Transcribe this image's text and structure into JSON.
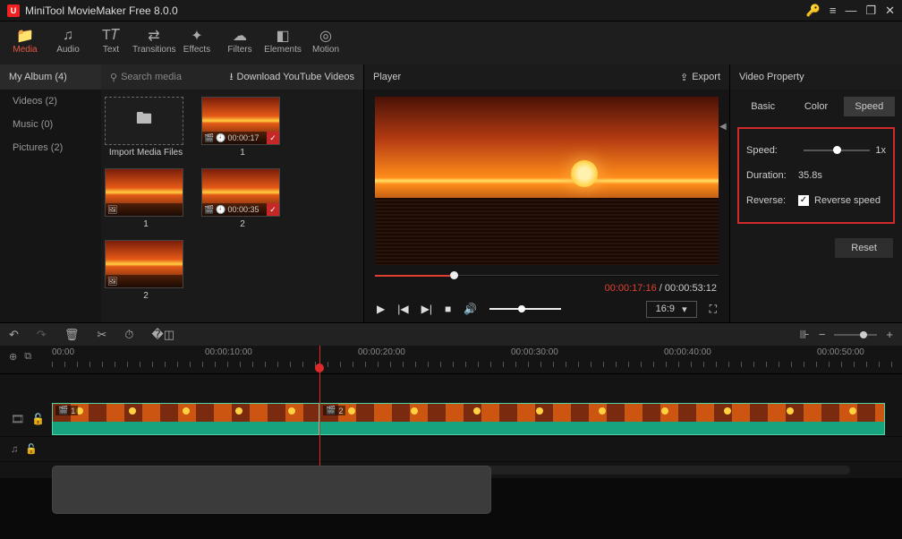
{
  "app": {
    "title": "MiniTool MovieMaker Free 8.0.0"
  },
  "ribbon": [
    {
      "label": "Media",
      "icon": "📁",
      "active": true
    },
    {
      "label": "Audio",
      "icon": "♫"
    },
    {
      "label": "Text",
      "icon": "T𝑇"
    },
    {
      "label": "Transitions",
      "icon": "⇄"
    },
    {
      "label": "Effects",
      "icon": "✦"
    },
    {
      "label": "Filters",
      "icon": "☁"
    },
    {
      "label": "Elements",
      "icon": "◧"
    },
    {
      "label": "Motion",
      "icon": "◎"
    }
  ],
  "album": {
    "header": "My Album (4)",
    "items": [
      {
        "label": "Videos (2)"
      },
      {
        "label": "Music (0)"
      },
      {
        "label": "Pictures (2)"
      }
    ]
  },
  "search": {
    "placeholder": "Search media",
    "download": "Download YouTube Videos"
  },
  "media": {
    "import_label": "Import Media Files",
    "caps": [
      "1",
      "1",
      "1",
      "2",
      "2"
    ],
    "durations": [
      "00:00:17",
      "00:00:35"
    ]
  },
  "player": {
    "title": "Player",
    "export": "Export",
    "cur": "00:00:17:16",
    "total": "00:00:53:12",
    "aspect": "16:9"
  },
  "prop": {
    "title": "Video Property",
    "tabs": [
      "Basic",
      "Color",
      "Speed"
    ],
    "speed_label": "Speed:",
    "speed_value": "1x",
    "duration_label": "Duration:",
    "duration_value": "35.8s",
    "reverse_label": "Reverse:",
    "reverse_chk": "Reverse speed",
    "reset": "Reset"
  },
  "ruler": {
    "labels": [
      "00:00",
      "00:00:10:00",
      "00:00:20:00",
      "00:00:30:00",
      "00:00:40:00",
      "00:00:50:00"
    ],
    "positions": [
      0,
      18,
      36,
      54,
      72,
      90
    ]
  },
  "clips": {
    "a": {
      "label": "1"
    },
    "b": {
      "label": "2"
    }
  }
}
